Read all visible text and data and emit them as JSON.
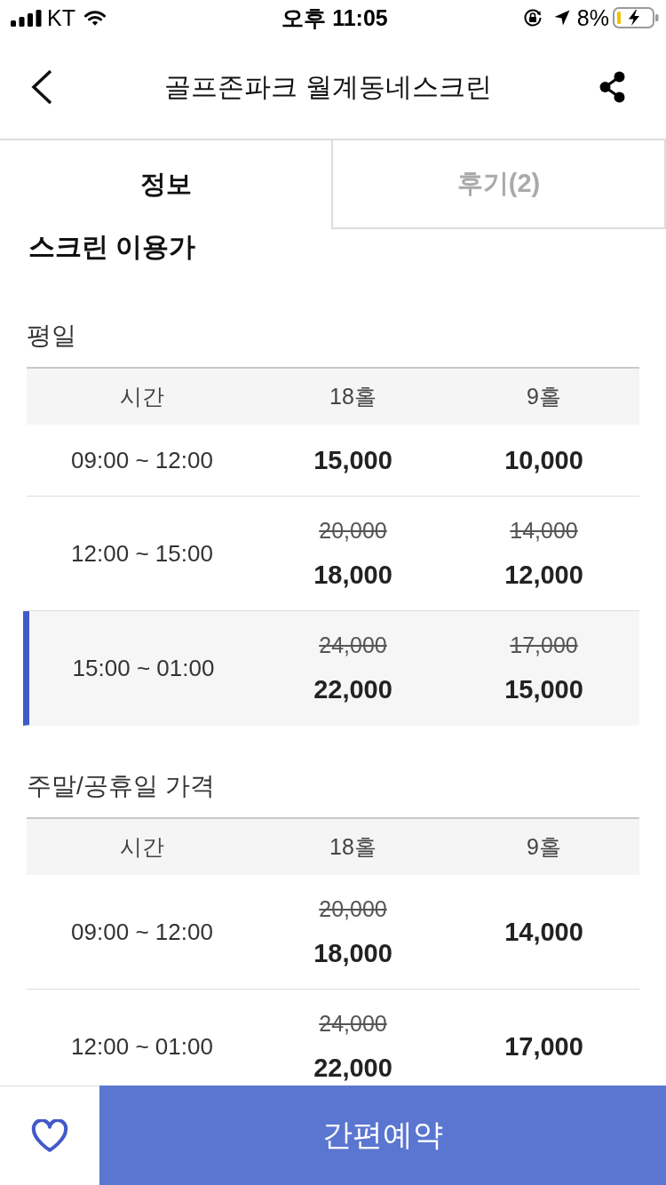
{
  "status_bar": {
    "carrier": "KT",
    "time": "오후 11:05",
    "battery": "8%"
  },
  "header": {
    "title": "골프존파크 월계동네스크린"
  },
  "tabs": [
    {
      "label": "정보",
      "selected": true
    },
    {
      "label": "후기(2)",
      "selected": false
    }
  ],
  "price_panel": {
    "title": "스크린 이용가",
    "tables": [
      {
        "title": "평일",
        "columns": [
          "시간",
          "18홀",
          "9홀"
        ],
        "rows": [
          {
            "time": "09:00 ~ 12:00",
            "selected": false,
            "prices": [
              {
                "price": "15,000"
              },
              {
                "price": "10,000"
              }
            ]
          },
          {
            "time": "12:00 ~ 15:00",
            "selected": false,
            "prices": [
              {
                "original": "20,000",
                "price": "18,000"
              },
              {
                "original": "14,000",
                "price": "12,000"
              }
            ]
          },
          {
            "time": "15:00 ~ 01:00",
            "selected": true,
            "prices": [
              {
                "original": "24,000",
                "price": "22,000"
              },
              {
                "original": "17,000",
                "price": "15,000"
              }
            ]
          }
        ]
      },
      {
        "title": "주말/공휴일 가격",
        "columns": [
          "시간",
          "18홀",
          "9홀"
        ],
        "rows": [
          {
            "time": "09:00 ~ 12:00",
            "selected": false,
            "prices": [
              {
                "original": "20,000",
                "price": "18,000"
              },
              {
                "price": "14,000"
              }
            ]
          },
          {
            "time": "12:00 ~ 01:00",
            "selected": false,
            "prices": [
              {
                "original": "24,000",
                "price": "22,000"
              },
              {
                "price": "17,000"
              }
            ]
          }
        ]
      }
    ]
  },
  "bottom_bar": {
    "favorited": false,
    "button": "간편예약"
  }
}
